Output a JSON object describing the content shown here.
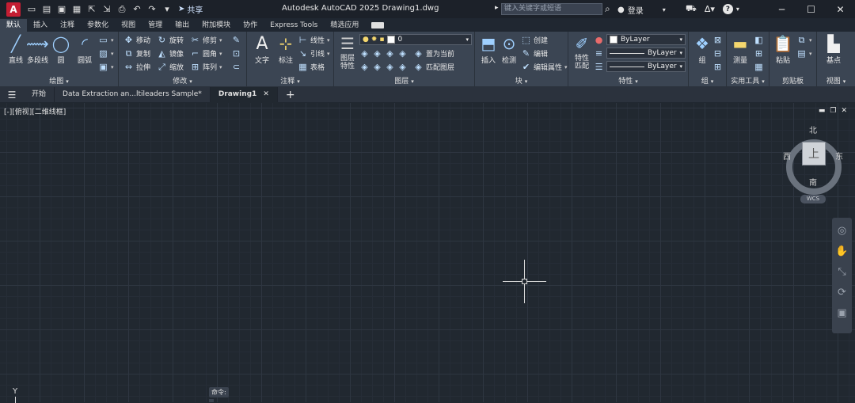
{
  "title_bar": {
    "app_logo": "A",
    "share_label": "共享",
    "title": "Autodesk AutoCAD 2025    Drawing1.dwg",
    "search_placeholder": "键入关键字或短语",
    "login_label": "登录",
    "help_label": "?"
  },
  "ribbon_tabs": [
    "默认",
    "插入",
    "注释",
    "参数化",
    "视图",
    "管理",
    "输出",
    "附加模块",
    "协作",
    "Express Tools",
    "精选应用"
  ],
  "panels": {
    "draw": {
      "title": "绘图",
      "line": "直线",
      "polyline": "多段线",
      "circle": "圆",
      "arc": "圆弧"
    },
    "modify": {
      "title": "修改",
      "move": "移动",
      "rotate": "旋转",
      "trim": "修剪",
      "copy": "复制",
      "mirror": "镜像",
      "fillet": "圆角",
      "stretch": "拉伸",
      "scale": "缩放",
      "array": "阵列"
    },
    "annotation": {
      "title": "注释",
      "text": "文字",
      "dimension": "标注",
      "linear": "线性",
      "leader": "引线",
      "table": "表格"
    },
    "layers": {
      "title": "图层",
      "layer_properties": "图层\n特性",
      "layer_name": "0",
      "set_current": "置为当前",
      "match_layer": "匹配图层"
    },
    "block": {
      "title": "块",
      "insert": "插入",
      "inspect": "检测",
      "create": "创建",
      "edit": "编辑",
      "edit_attributes": "编辑属性"
    },
    "properties": {
      "title": "特性",
      "match_properties": "特性\n匹配",
      "color": "ByLayer",
      "linetype": "ByLayer",
      "lineweight": "ByLayer"
    },
    "groups": {
      "title": "组",
      "group": "组"
    },
    "utilities": {
      "title": "实用工具",
      "measure": "测量"
    },
    "clipboard": {
      "title": "剪贴板",
      "paste": "粘贴"
    },
    "view": {
      "title": "视图",
      "base": "基点"
    }
  },
  "file_tabs": {
    "start": "开始",
    "tab1": "Data Extraction an...ltileaders Sample*",
    "tab2": "Drawing1"
  },
  "viewport": {
    "label": "[-][俯视][二维线框]",
    "north": "北",
    "south": "南",
    "east": "东",
    "west": "西",
    "top_face": "上",
    "wcs": "WCS",
    "ucs_axis": "Y",
    "command_hint": "命令:"
  }
}
